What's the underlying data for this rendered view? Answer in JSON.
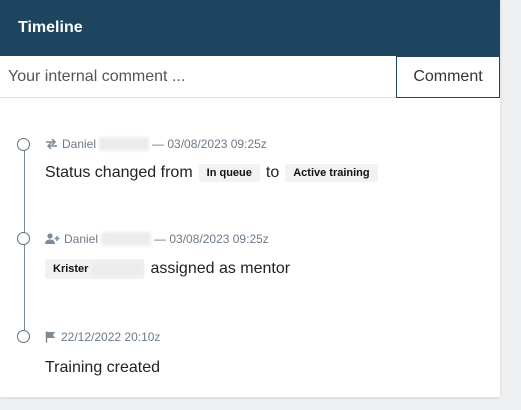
{
  "header": {
    "title": "Timeline"
  },
  "comment": {
    "placeholder": "Your internal comment ...",
    "button_label": "Comment"
  },
  "events": [
    {
      "icon": "swap-arrows-icon",
      "author": "Daniel",
      "separator": "— 03/08/2023 09:25z",
      "text_before": "Status changed from",
      "from_status": "In queue",
      "text_mid": "to",
      "to_status": "Active training"
    },
    {
      "icon": "add-user-icon",
      "author": "Daniel",
      "separator": "— 03/08/2023 09:25z",
      "mentor_name": "Krister",
      "text_after": "assigned as mentor"
    },
    {
      "icon": "flag-icon",
      "timestamp": "22/12/2022 20:10z",
      "text": "Training created"
    }
  ],
  "colors": {
    "header_bg": "#1e4560",
    "timeline_line": "#7d8a98"
  }
}
